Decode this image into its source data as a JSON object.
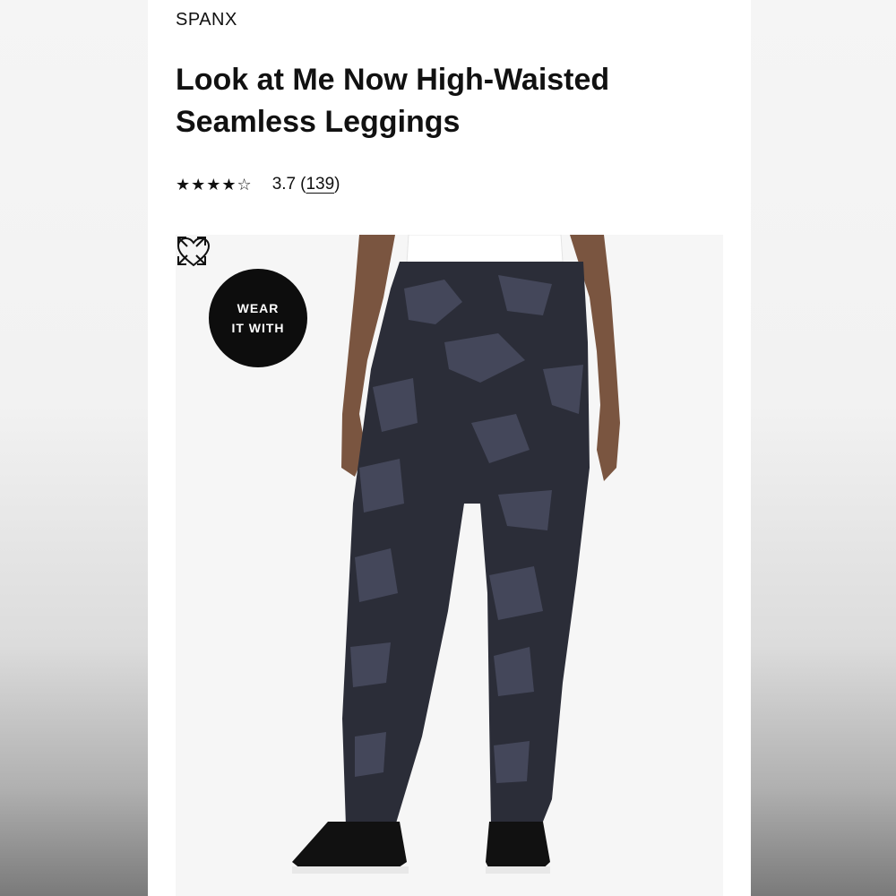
{
  "product": {
    "brand": "SPANX",
    "title": "Look at Me Now High-Waisted Seamless Leggings",
    "rating": {
      "stars": 3.7,
      "stars_display": "★★★★☆",
      "value": "3.7",
      "open_paren": "(",
      "review_count": "139",
      "close_paren": ")"
    }
  },
  "gallery": {
    "badge_line1": "WEAR",
    "badge_line2": "IT WITH",
    "icons": {
      "favorite": "heart-icon",
      "fullscreen": "expand-icon"
    }
  },
  "colors": {
    "text": "#111111",
    "badge_bg": "#0d0d0d",
    "leggings": "#2b2d38",
    "camo": "#44475a"
  }
}
